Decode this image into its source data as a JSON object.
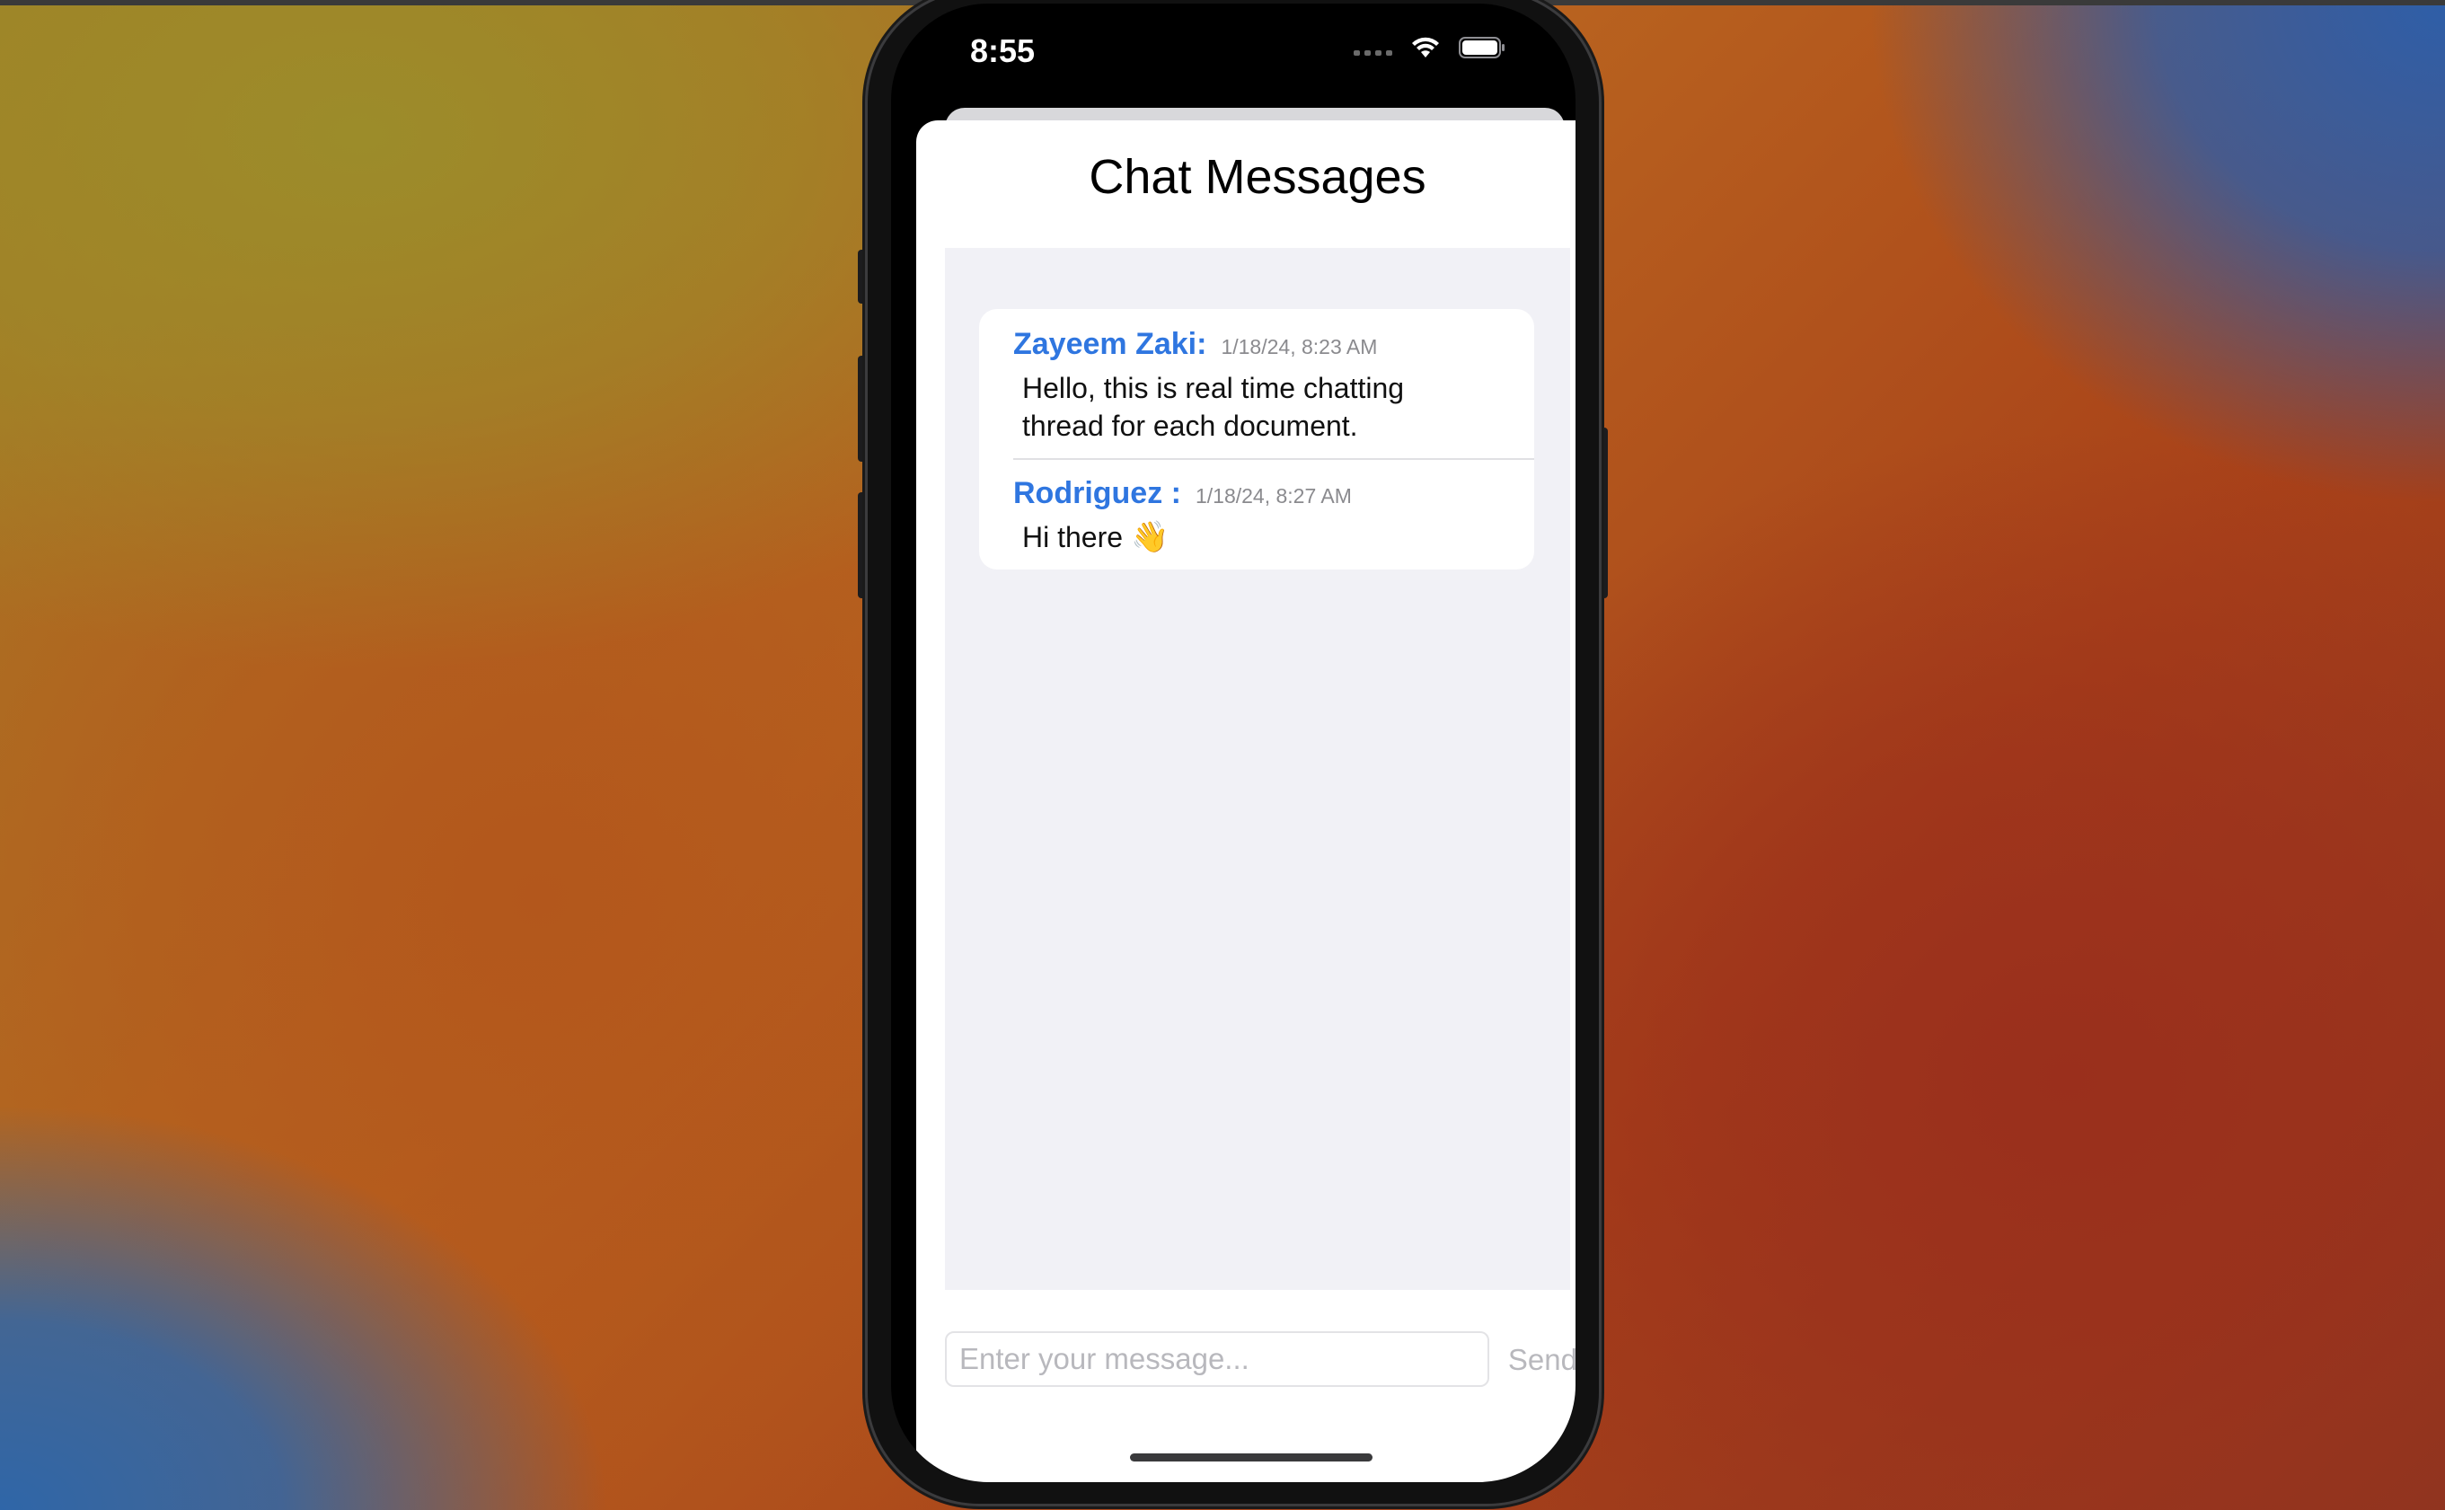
{
  "status_bar": {
    "time": "8:55",
    "icons": [
      "cellular-signal-icon",
      "wifi-icon",
      "battery-icon"
    ]
  },
  "header": {
    "title": "Chat Messages"
  },
  "messages": [
    {
      "sender": "Zayeem Zaki:",
      "timestamp": "1/18/24, 8:23 AM",
      "text": "Hello, this is real time chatting thread for each document."
    },
    {
      "sender": "Rodriguez :",
      "timestamp": "1/18/24, 8:27 AM",
      "text": "Hi there",
      "emoji": "👋"
    }
  ],
  "composer": {
    "placeholder": "Enter your message...",
    "value": "",
    "send_label": "Send"
  },
  "colors": {
    "sender_name": "#2f76e0",
    "timestamp": "#8a8a8e",
    "chat_background": "#f1f1f6",
    "disabled_send": "#b8b8bd"
  }
}
